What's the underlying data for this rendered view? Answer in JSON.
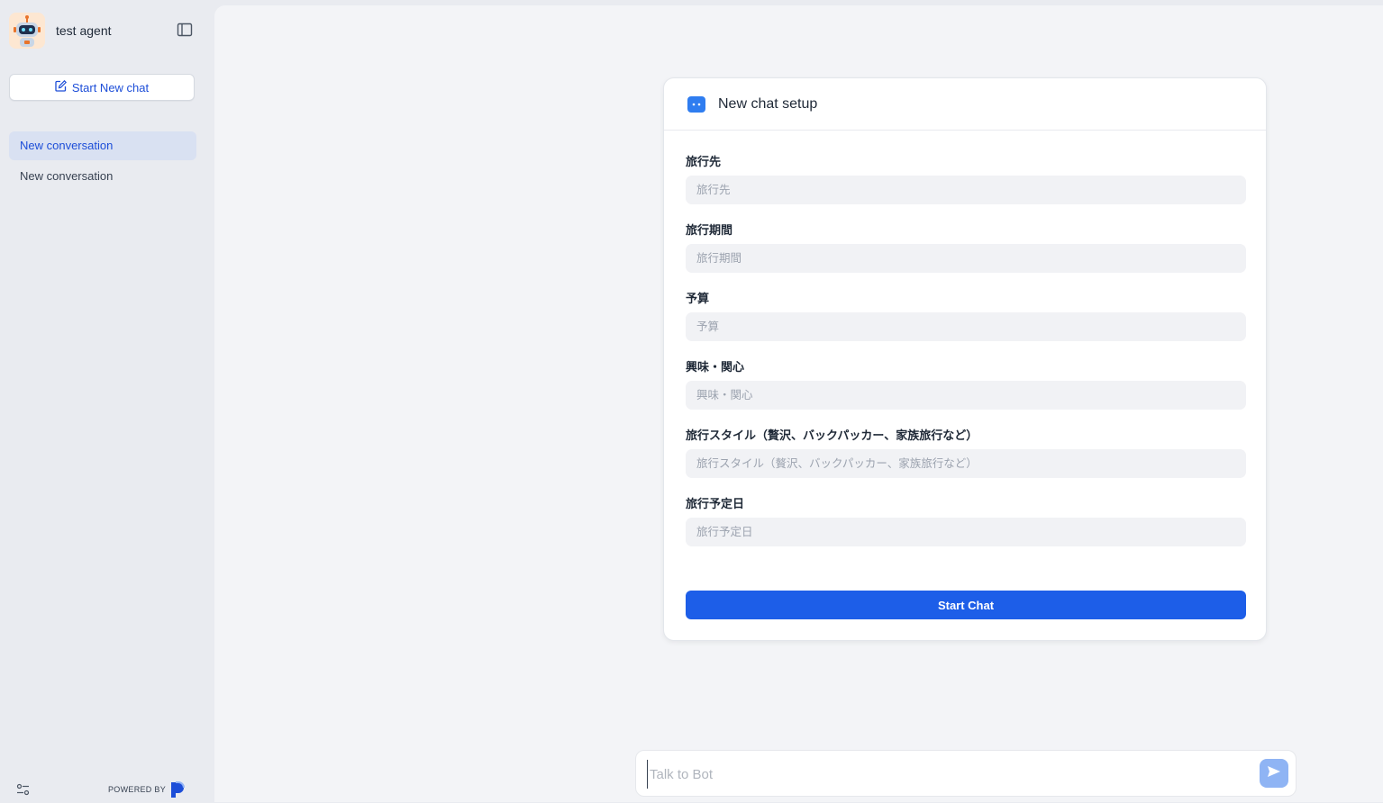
{
  "sidebar": {
    "agent_name": "test agent",
    "new_chat_label": "Start New chat",
    "conversations": [
      {
        "label": "New conversation",
        "active": true
      },
      {
        "label": "New conversation",
        "active": false
      }
    ],
    "powered_by": "POWERED BY"
  },
  "setup": {
    "title": "New chat setup",
    "fields": [
      {
        "label": "旅行先",
        "placeholder": "旅行先"
      },
      {
        "label": "旅行期間",
        "placeholder": "旅行期間"
      },
      {
        "label": "予算",
        "placeholder": "予算"
      },
      {
        "label": "興味・関心",
        "placeholder": "興味・関心"
      },
      {
        "label": "旅行スタイル（贅沢、バックパッカー、家族旅行など）",
        "placeholder": "旅行スタイル（贅沢、バックパッカー、家族旅行など）"
      },
      {
        "label": "旅行予定日",
        "placeholder": "旅行予定日"
      }
    ],
    "start_label": "Start Chat"
  },
  "composer": {
    "placeholder": "Talk to Bot"
  },
  "colors": {
    "accent": "#1d5ee8",
    "sidebar_bg": "#e9ebf0",
    "active_item_bg": "#d9e1f2",
    "send_button": "#8fb4f4"
  },
  "icons": {
    "toggle": "sidebar-toggle-icon",
    "new_chat": "edit-icon",
    "bot": "bot-icon",
    "settings": "sliders-icon",
    "send": "send-icon"
  }
}
